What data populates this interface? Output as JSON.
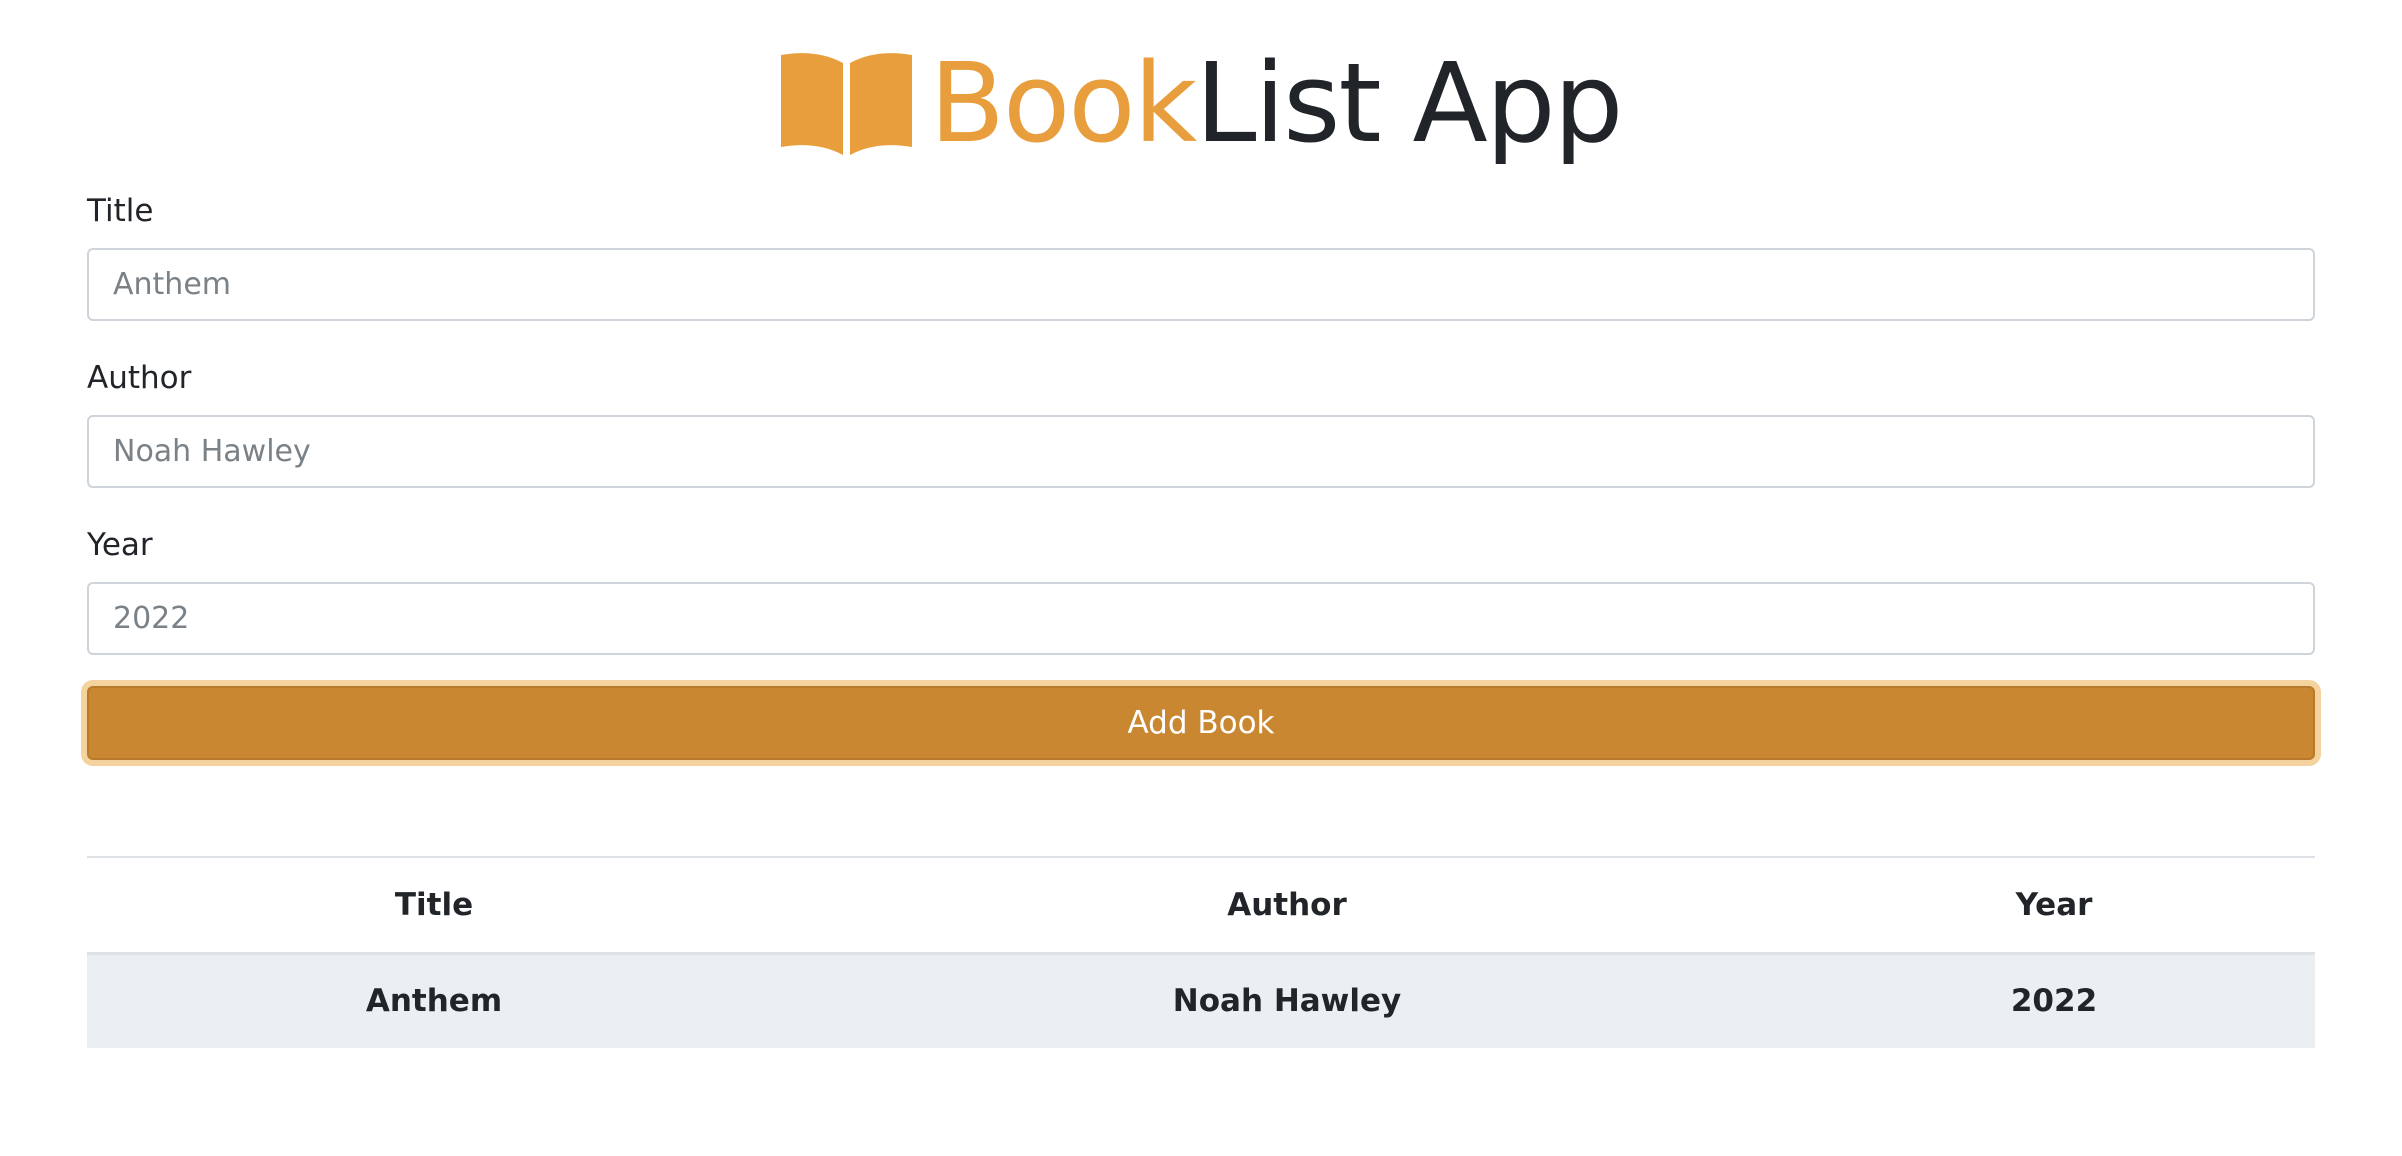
{
  "app": {
    "title_accent": "Book",
    "title_rest": "List App",
    "icon": "open-book-icon",
    "accent_color": "#e89e3c",
    "button_color": "#c98731"
  },
  "form": {
    "title_label": "Title",
    "title_placeholder": "Anthem",
    "author_label": "Author",
    "author_placeholder": "Noah Hawley",
    "year_label": "Year",
    "year_placeholder": "2022",
    "submit_label": "Add Book"
  },
  "table": {
    "headers": [
      "Title",
      "Author",
      "Year"
    ],
    "rows": [
      [
        "Anthem",
        "Noah Hawley",
        "2022"
      ]
    ]
  }
}
